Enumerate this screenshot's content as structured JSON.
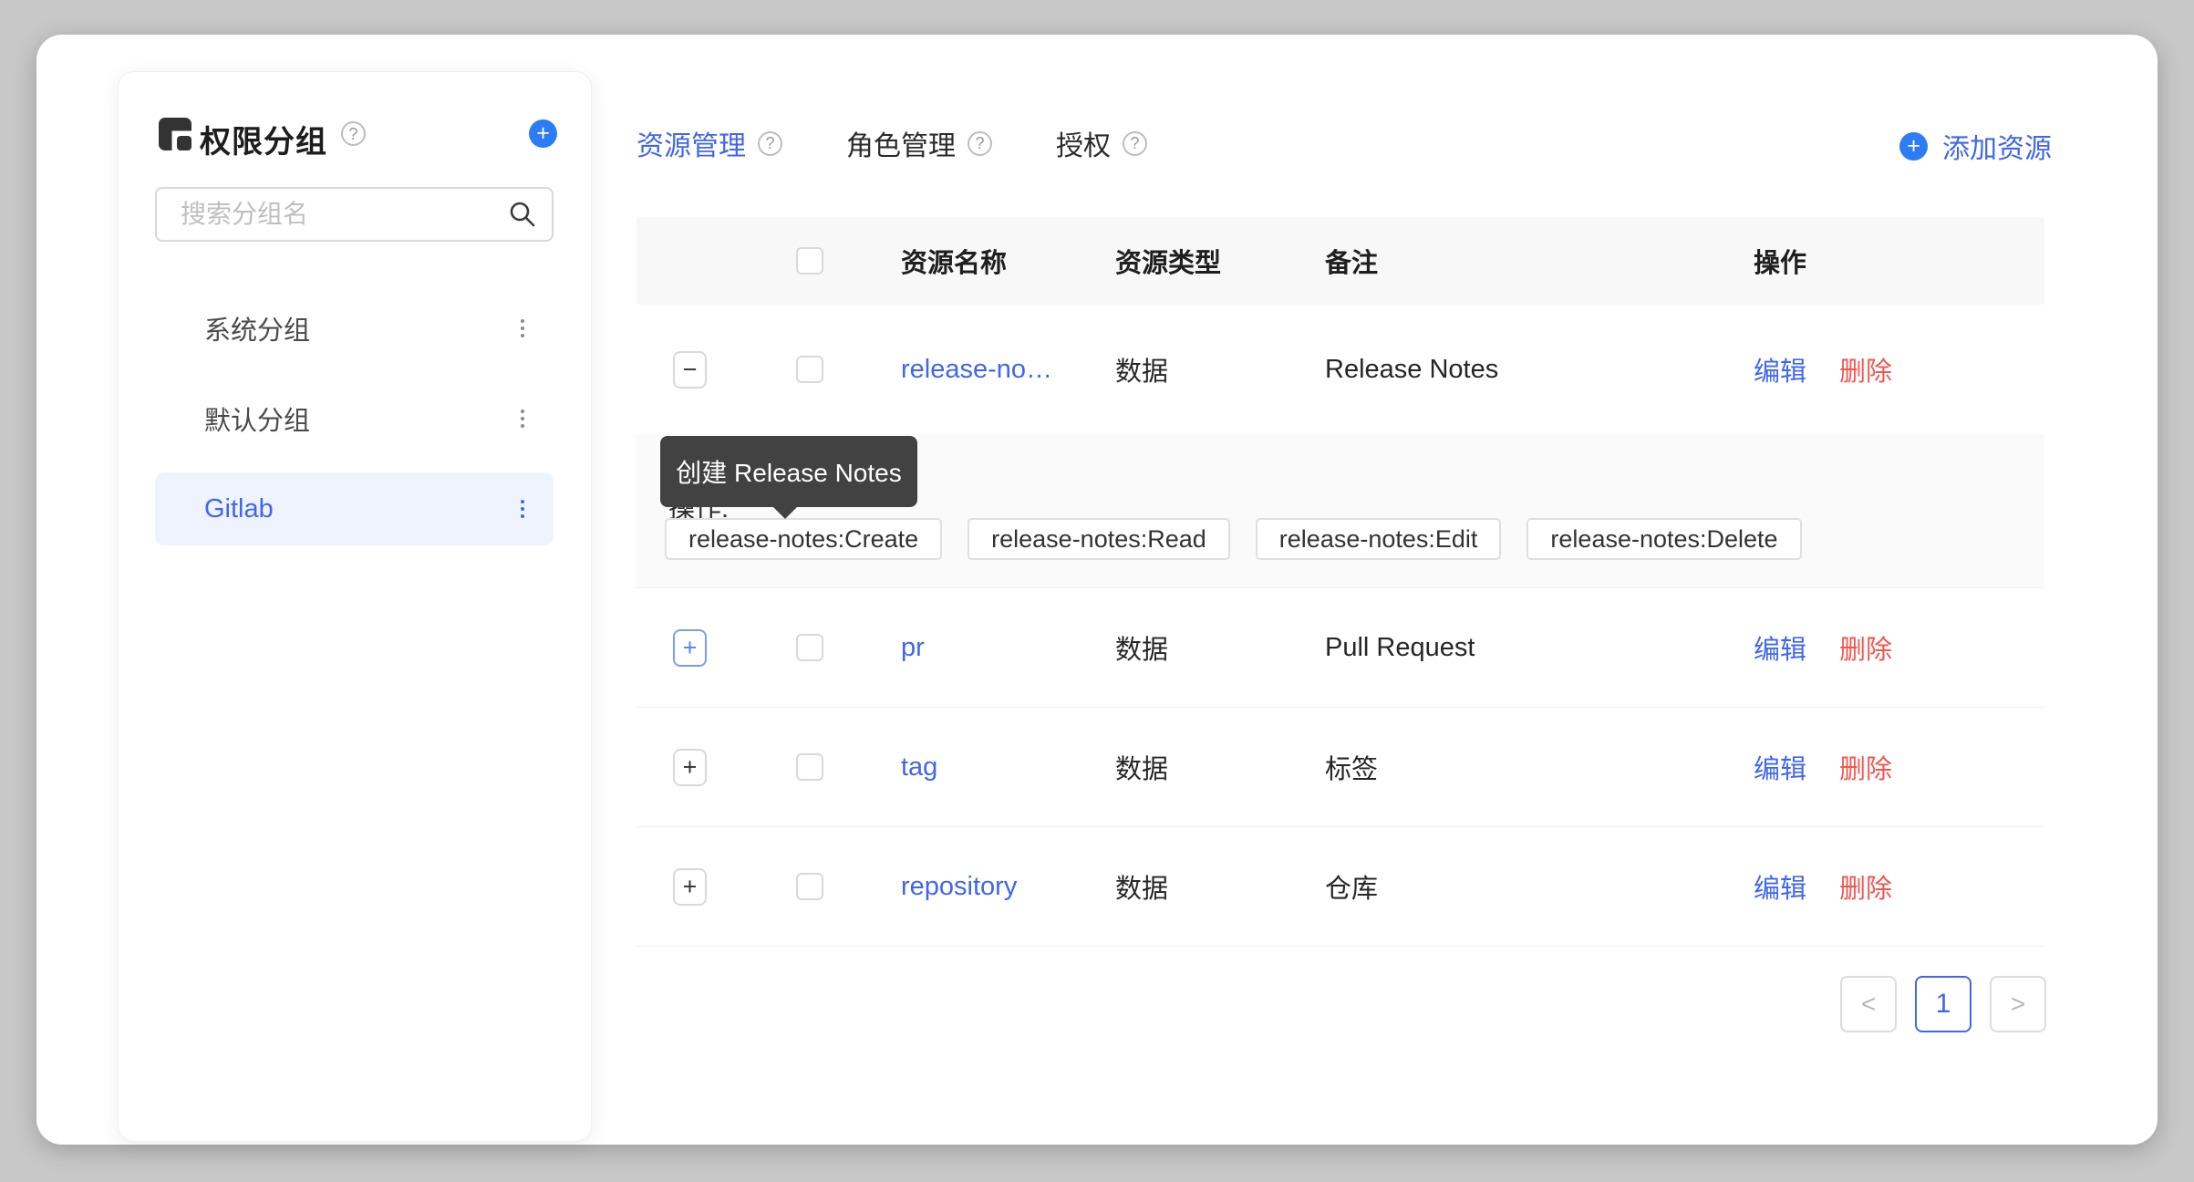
{
  "sidebar": {
    "title": "权限分组",
    "search_placeholder": "搜索分组名",
    "groups": [
      {
        "label": "系统分组",
        "active": false
      },
      {
        "label": "默认分组",
        "active": false
      },
      {
        "label": "Gitlab",
        "active": true
      }
    ]
  },
  "tabs": [
    {
      "label": "资源管理",
      "active": true
    },
    {
      "label": "角色管理",
      "active": false
    },
    {
      "label": "授权",
      "active": false
    }
  ],
  "help_glyph": "?",
  "plus_glyph": "+",
  "minus_glyph": "−",
  "add_resource_label": "添加资源",
  "table": {
    "columns": {
      "name": "资源名称",
      "type": "资源类型",
      "note": "备注",
      "actions": "操作"
    },
    "rows": [
      {
        "name": "release-no…",
        "type": "数据",
        "note": "Release Notes"
      },
      {
        "name": "pr",
        "type": "数据",
        "note": "Pull Request"
      },
      {
        "name": "tag",
        "type": "数据",
        "note": "标签"
      },
      {
        "name": "repository",
        "type": "数据",
        "note": "仓库"
      }
    ],
    "edit_label": "编辑",
    "delete_label": "删除",
    "expanded_panel": {
      "label": "操作:",
      "permissions": [
        "release-notes:Create",
        "release-notes:Read",
        "release-notes:Edit",
        "release-notes:Delete"
      ]
    }
  },
  "tooltip": {
    "text": "创建 Release Notes"
  },
  "pagination": {
    "current": "1",
    "prev_glyph": "<",
    "next_glyph": ">"
  },
  "colors": {
    "primary": "#4166EE",
    "circleBlue": "#2D7CF5",
    "red": "#F15750",
    "textDark": "#262626",
    "textGray": "#4a4a4a",
    "border": "#dcdcdc",
    "divider": "#efefef",
    "headerBg": "#f8f8f8",
    "expandedBg": "#fafafa",
    "tooltipBg": "#424242",
    "activeItemBg": "#EEF3FD"
  }
}
